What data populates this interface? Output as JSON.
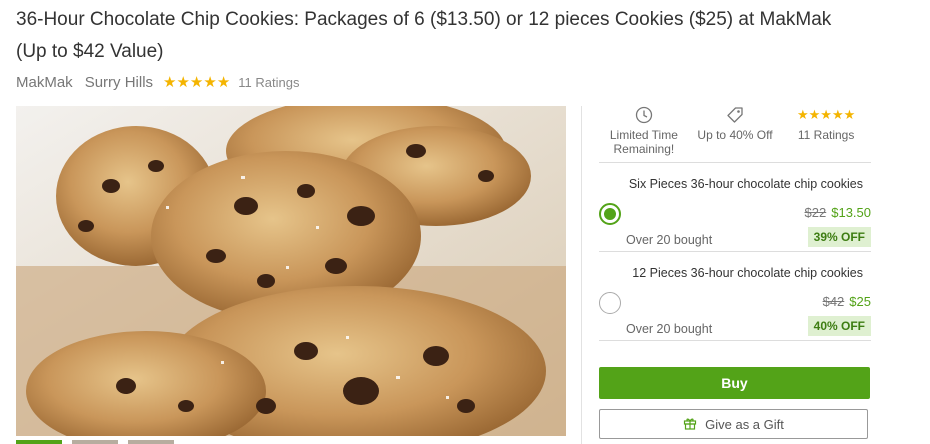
{
  "deal": {
    "title": "36-Hour Chocolate Chip Cookies: Packages of 6 ($13.50) or 12 pieces Cookies ($25) at MakMak (Up to $42 Value)",
    "merchant": "MakMak",
    "location": "Surry Hills",
    "stars": "★★★★★",
    "rating_count": "11 Ratings",
    "rating_value": 5
  },
  "features": [
    {
      "icon": "clock-icon",
      "label": "Limited Time Remaining!"
    },
    {
      "icon": "tag-icon",
      "label": "Up to 40% Off"
    },
    {
      "icon": "stars",
      "label": "11 Ratings",
      "stars": "★★★★★"
    }
  ],
  "options": [
    {
      "name": "Six Pieces 36-hour chocolate chip cookies",
      "old_price": "$22",
      "new_price": "$13.50",
      "discount": "39% OFF",
      "bought": "Over 20 bought",
      "selected": true
    },
    {
      "name": "12 Pieces 36-hour chocolate chip cookies",
      "old_price": "$42",
      "new_price": "$25",
      "discount": "40% OFF",
      "bought": "Over 20 bought",
      "selected": false
    }
  ],
  "actions": {
    "buy": "Buy",
    "gift": "Give as a Gift"
  },
  "colors": {
    "accent": "#53a318",
    "star": "#f4b400",
    "badge_bg": "#dff0d1"
  }
}
